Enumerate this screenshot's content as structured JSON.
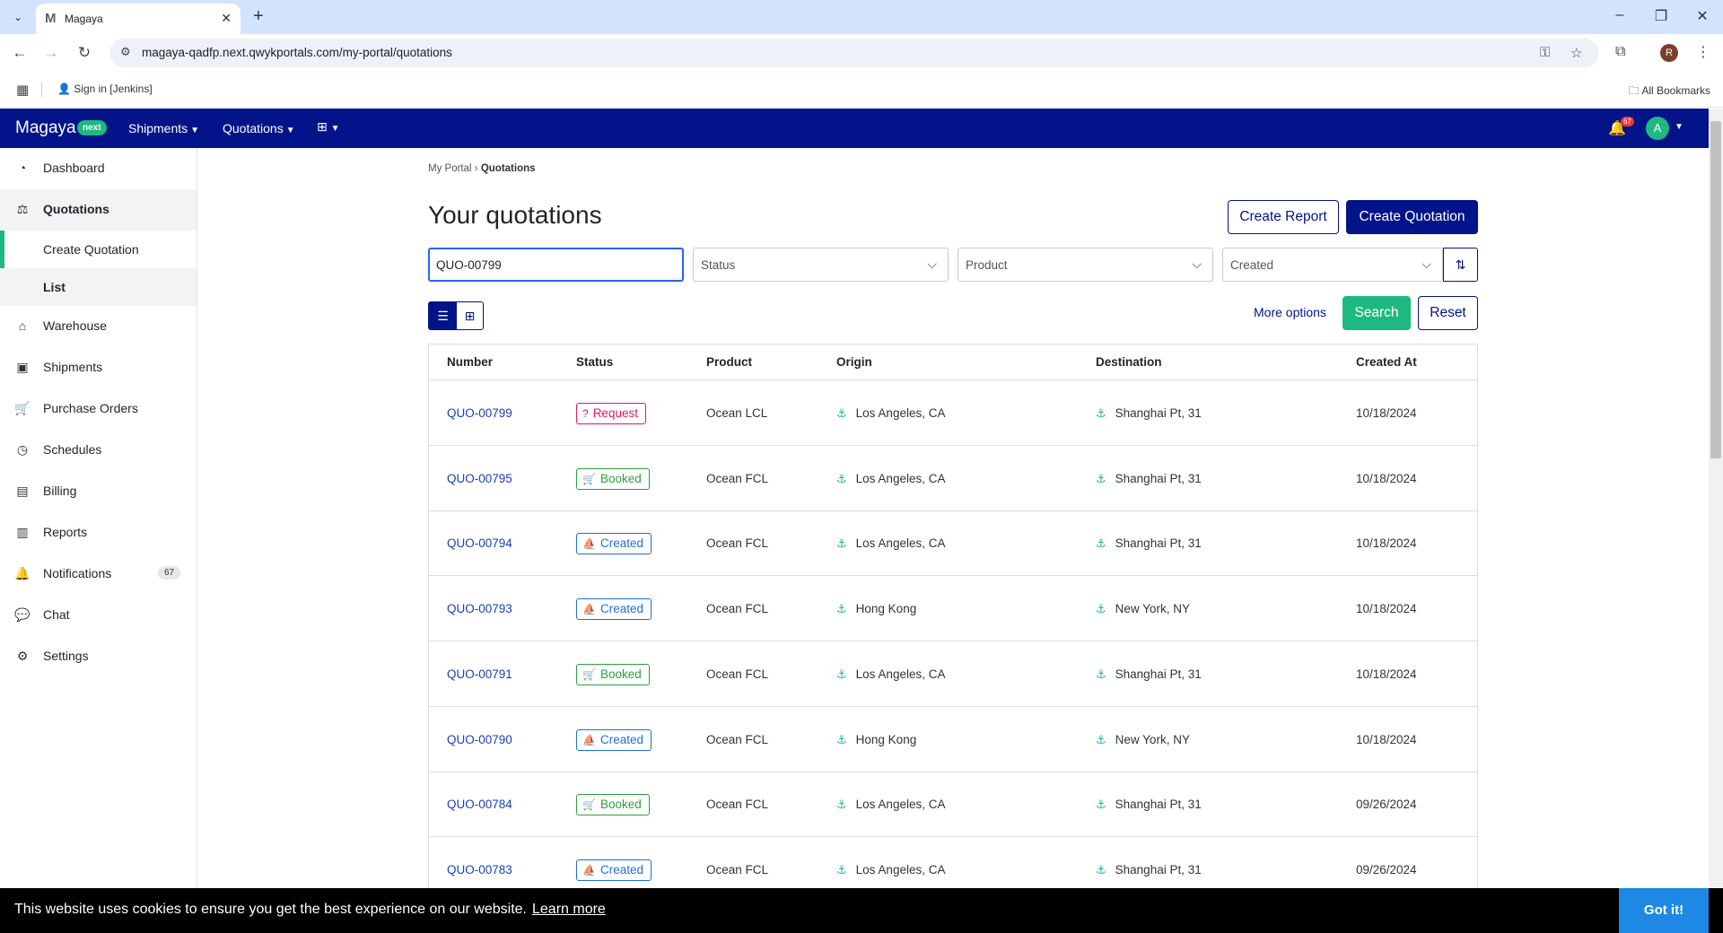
{
  "browser": {
    "tab_title": "Magaya",
    "tab_favicon": "M",
    "url": "magaya-qadfp.next.qwykportals.com/my-portal/quotations",
    "bookmark_item": "Sign in [Jenkins]",
    "all_bookmarks": "All Bookmarks",
    "profile_initial": "R"
  },
  "header": {
    "brand": "Magaya",
    "brand_badge": "next",
    "nav": [
      {
        "label": "Shipments"
      },
      {
        "label": "Quotations"
      }
    ],
    "notification_count": "67",
    "avatar_initial": "A",
    "bg_color": "#031389"
  },
  "sidebar": {
    "items": [
      {
        "label": "Dashboard",
        "icon": "dashboard-icon"
      },
      {
        "label": "Quotations",
        "icon": "quotations-icon"
      },
      {
        "label": "Create Quotation"
      },
      {
        "label": "List"
      },
      {
        "label": "Warehouse",
        "icon": "warehouse-icon"
      },
      {
        "label": "Shipments",
        "icon": "box-icon"
      },
      {
        "label": "Purchase Orders",
        "icon": "cart-icon"
      },
      {
        "label": "Schedules",
        "icon": "clock-icon"
      },
      {
        "label": "Billing",
        "icon": "billing-icon"
      },
      {
        "label": "Reports",
        "icon": "chart-icon"
      },
      {
        "label": "Notifications",
        "icon": "bell-icon",
        "count": "67"
      },
      {
        "label": "Chat",
        "icon": "chat-icon"
      },
      {
        "label": "Settings",
        "icon": "gear-icon"
      }
    ],
    "accent_color": "#1eb980"
  },
  "main": {
    "breadcrumb_root": "My Portal",
    "breadcrumb_sep": "›",
    "breadcrumb_current": "Quotations",
    "title": "Your quotations",
    "create_report": "Create Report",
    "create_quotation": "Create Quotation",
    "filters": {
      "search_value": "QUO-00799",
      "status_placeholder": "Status",
      "product_placeholder": "Product",
      "sort_value": "Created"
    },
    "more_options": "More options",
    "search_button": "Search",
    "reset_button": "Reset",
    "columns": [
      "Number",
      "Status",
      "Product",
      "Origin",
      "Destination",
      "Created At"
    ],
    "rows": [
      {
        "number": "QUO-00799",
        "status": "Request",
        "product": "Ocean LCL",
        "origin": "Los Angeles, CA",
        "destination": "Shanghai Pt, 31",
        "created": "10/18/2024"
      },
      {
        "number": "QUO-00795",
        "status": "Booked",
        "product": "Ocean FCL",
        "origin": "Los Angeles, CA",
        "destination": "Shanghai Pt, 31",
        "created": "10/18/2024"
      },
      {
        "number": "QUO-00794",
        "status": "Created",
        "product": "Ocean FCL",
        "origin": "Los Angeles, CA",
        "destination": "Shanghai Pt, 31",
        "created": "10/18/2024"
      },
      {
        "number": "QUO-00793",
        "status": "Created",
        "product": "Ocean FCL",
        "origin": "Hong Kong",
        "destination": "New York, NY",
        "created": "10/18/2024"
      },
      {
        "number": "QUO-00791",
        "status": "Booked",
        "product": "Ocean FCL",
        "origin": "Los Angeles, CA",
        "destination": "Shanghai Pt, 31",
        "created": "10/18/2024"
      },
      {
        "number": "QUO-00790",
        "status": "Created",
        "product": "Ocean FCL",
        "origin": "Hong Kong",
        "destination": "New York, NY",
        "created": "10/18/2024"
      },
      {
        "number": "QUO-00784",
        "status": "Booked",
        "product": "Ocean FCL",
        "origin": "Los Angeles, CA",
        "destination": "Shanghai Pt, 31",
        "created": "09/26/2024"
      },
      {
        "number": "QUO-00783",
        "status": "Created",
        "product": "Ocean FCL",
        "origin": "Los Angeles, CA",
        "destination": "Shanghai Pt, 31",
        "created": "09/26/2024"
      }
    ],
    "status_colors": {
      "Request": "#e0195f",
      "Booked": "#2e9e3f",
      "Created": "#1f6fd6"
    }
  },
  "cookie": {
    "message": "This website uses cookies to ensure you get the best experience on our website.",
    "learn_more": "Learn more",
    "button": "Got it!"
  }
}
